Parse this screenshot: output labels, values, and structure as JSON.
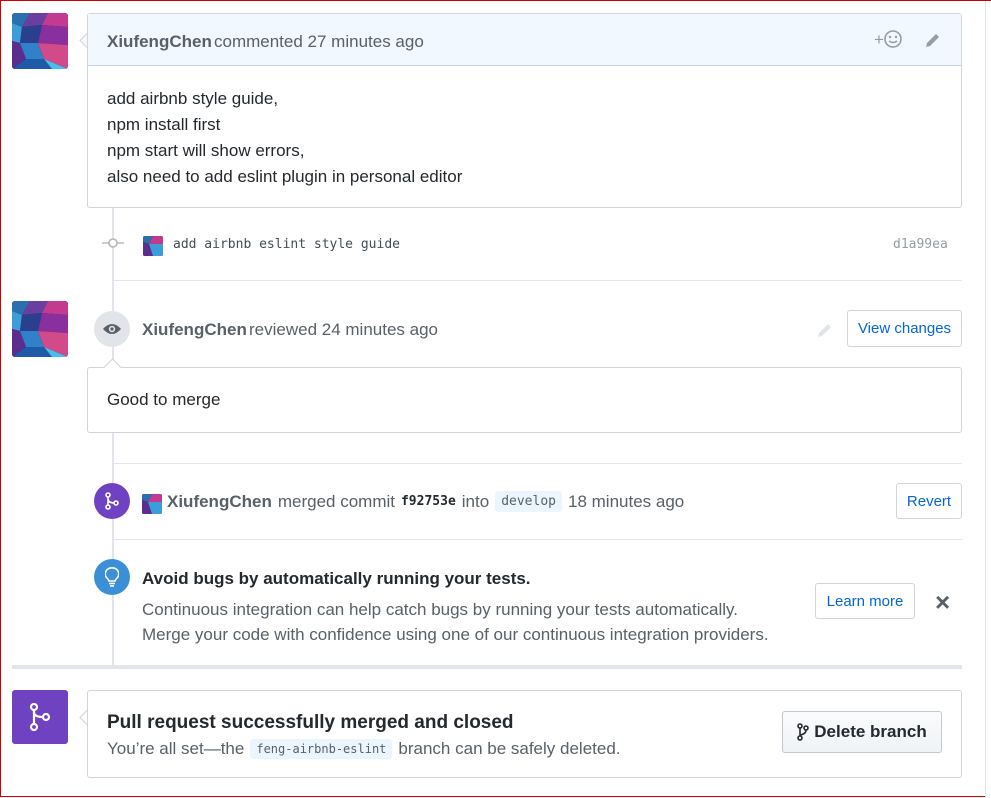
{
  "comment": {
    "author": "XiufengChen",
    "action": "commented 27 minutes ago",
    "lines": [
      "add airbnb style guide,",
      "npm install first",
      "npm start will show errors,",
      "also need to add eslint plugin in personal editor"
    ],
    "reaction_icon": "smiley-add-icon",
    "edit_icon": "pencil-icon"
  },
  "commit": {
    "message": "add airbnb eslint style guide",
    "sha": "d1a99ea"
  },
  "review": {
    "author": "XiufengChen",
    "action": "reviewed 24 minutes ago",
    "view_changes_label": "View changes",
    "body": "Good to merge"
  },
  "merge": {
    "author": "XiufengChen",
    "text_before": "merged commit",
    "commit_sha": "f92753e",
    "text_into": "into",
    "branch": "develop",
    "time": "18 minutes ago",
    "revert_label": "Revert"
  },
  "ci": {
    "title": "Avoid bugs by automatically running your tests.",
    "line1": "Continuous integration can help catch bugs by running your tests automatically.",
    "line2": "Merge your code with confidence using one of our continuous integration providers.",
    "learn_more_label": "Learn more",
    "close_icon": "×"
  },
  "merged_box": {
    "title": "Pull request successfully merged and closed",
    "text_before": "You’re all set—the",
    "branch": "feng-airbnb-eslint",
    "text_after": "branch can be safely deleted.",
    "delete_label": "Delete branch"
  },
  "colors": {
    "accent": "#0366d6",
    "merged_purple": "#6f42c1",
    "info_blue": "#2188ff",
    "header_bg": "#f1f8ff"
  }
}
